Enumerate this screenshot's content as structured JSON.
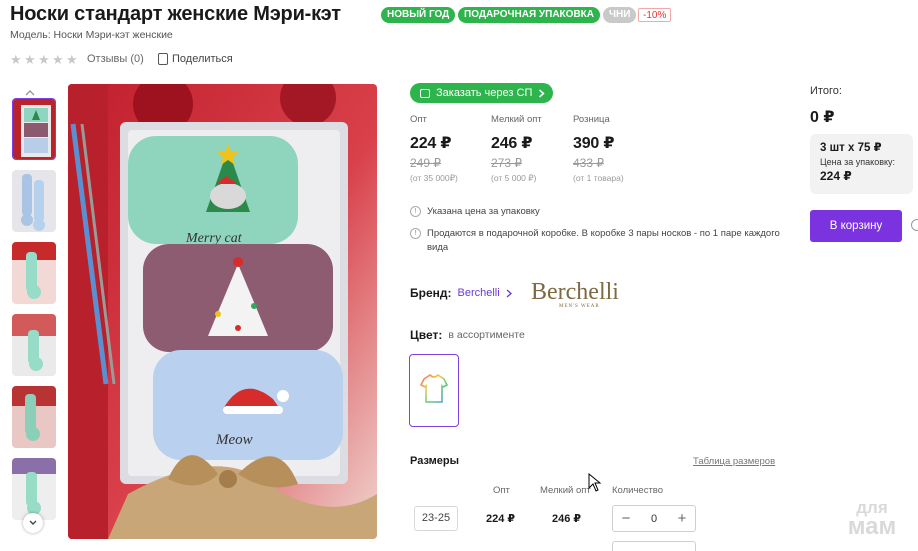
{
  "product": {
    "title": "Носки стандарт женские Мэри-кэт",
    "badges": {
      "new_year": "НОВЫЙ ГОД",
      "gift_pack": "ПОДАРОЧНАЯ УПАКОВКА",
      "chni": "ЧНИ",
      "discount": "-10%"
    },
    "model": "Модель: Носки Мэри-кэт женские",
    "rating": {
      "stars_filled": 0,
      "stars_total": 5
    },
    "reviews": "Отзывы (0)",
    "share": "Поделиться"
  },
  "order_sp": "Заказать через СП",
  "prices": [
    {
      "label": "Опт",
      "price": "224 ₽",
      "old": "249 ₽",
      "min": "(от 35 000₽)"
    },
    {
      "label": "Мелкий опт",
      "price": "246 ₽",
      "old": "273 ₽",
      "min": "(от 5 000 ₽)"
    },
    {
      "label": "Розница",
      "price": "390 ₽",
      "old": "433 ₽",
      "min": "(от 1 товара)"
    }
  ],
  "notes": [
    "Указана цена за упаковку",
    "Продаются в подарочной коробке. В коробке 3 пары носков - по 1 паре каждого вида"
  ],
  "brand": {
    "label": "Бренд:",
    "name": "Berchelli",
    "logo_text": "Berchelli",
    "logo_sub": "MEN'S WEAR"
  },
  "color": {
    "label": "Цвет:",
    "value": "в ассортименте"
  },
  "sizes": {
    "title": "Размеры",
    "table_link": "Таблица размеров",
    "headers": {
      "opt": "Опт",
      "small_opt": "Мелкий опт",
      "qty": "Количество"
    },
    "rows": [
      {
        "size": "23-25",
        "opt": "224 ₽",
        "small_opt": "246 ₽",
        "qty": "0"
      }
    ]
  },
  "summary": {
    "total_label": "Итого:",
    "total_value": "0 ₽",
    "pack_qty": "3 шт х 75 ₽",
    "pack_label": "Цена за упаковку:",
    "pack_price": "224 ₽",
    "cart_button": "В корзину"
  },
  "watermark": {
    "line1": "для",
    "line2": "мам"
  },
  "colors": {
    "accent": "#7b33e0",
    "green": "#2eb44d",
    "sale_red": "#e33333"
  },
  "icons": [
    "star-icon",
    "share-icon",
    "cart-icon",
    "info-icon",
    "chevron-right-icon",
    "chevron-up-icon",
    "chevron-down-icon",
    "minus-icon",
    "plus-icon",
    "tshirt-icon"
  ]
}
